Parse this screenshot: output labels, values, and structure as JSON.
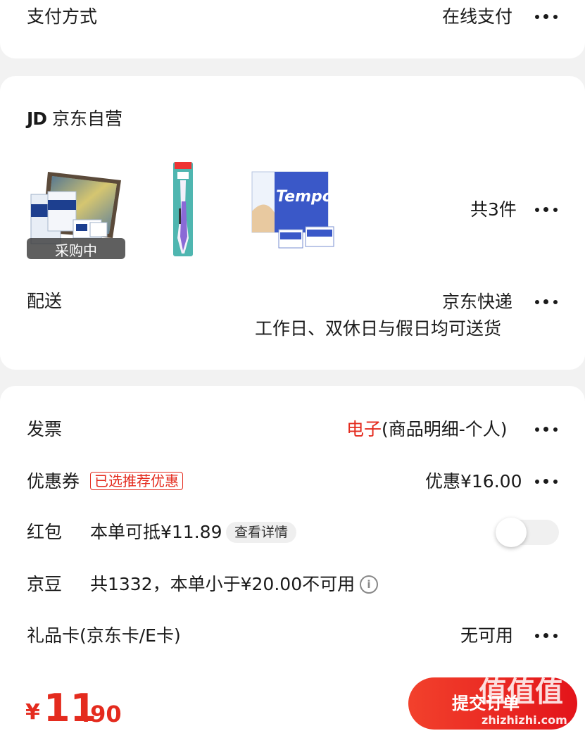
{
  "payment": {
    "label": "支付方式",
    "value": "在线支付"
  },
  "shop": {
    "logo": "JD",
    "name": "京东自营",
    "products": [
      {
        "icon": "tissue-box-product-image",
        "badge": "采购中"
      },
      {
        "icon": "toothbrush-product-image"
      },
      {
        "icon": "tempo-tissue-pack-product-image",
        "brand": "Tempo"
      }
    ],
    "count": "共3件"
  },
  "delivery": {
    "label": "配送",
    "value": "京东快递",
    "note": "工作日、双休日与假日均可送货"
  },
  "invoice": {
    "label": "发票",
    "type": "电子",
    "detail": "(商品明细-个人)"
  },
  "coupon": {
    "label": "优惠券",
    "tag": "已选推荐优惠",
    "value": "优惠¥16.00"
  },
  "red_packet": {
    "label": "红包",
    "text": "本单可抵¥11.89",
    "detail_button": "查看详情",
    "enabled": false
  },
  "jingdou": {
    "label": "京豆",
    "text": "共1332，本单小于¥20.00不可用"
  },
  "gift_card": {
    "label": "礼品卡(京东卡/E卡)",
    "value": "无可用"
  },
  "footer": {
    "currency": "¥",
    "amount_int": "11",
    "amount_dec": ".90",
    "submit_label": "提交订单"
  },
  "watermark": {
    "text": "值值值",
    "site": "zhizhizhi.com"
  },
  "colors": {
    "accent": "#e42b1e",
    "background": "#f2f2f2"
  }
}
